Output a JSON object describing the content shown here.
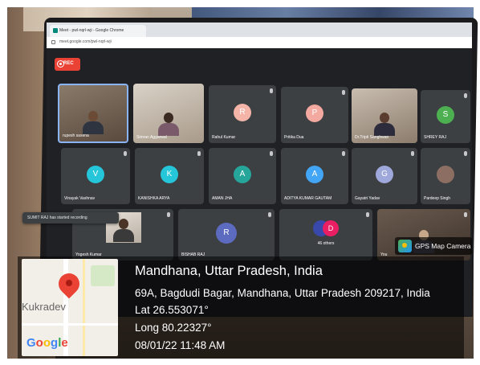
{
  "browser": {
    "tab_title": "Meet - pwl-nqrl-wji - Google Chrome",
    "url": "meet.google.com/pwl-nqrl-wji"
  },
  "meet": {
    "rec_label": "REC",
    "toast": "SUMIT RAJ has started recording",
    "participants": [
      {
        "name": "rupesh saxena",
        "kind": "video"
      },
      {
        "name": "Simran Aggarwal",
        "kind": "video"
      },
      {
        "name": "Rahul Kumar",
        "initial": "R",
        "color": "#f4b5a8"
      },
      {
        "name": "Pritika Dua",
        "initial": "P",
        "color": "#f4a9a0"
      },
      {
        "name": "Dr.Tripti Sanghwan",
        "kind": "video"
      },
      {
        "name": "SHREY RAJ",
        "initial": "S",
        "color": "#4caf50"
      },
      {
        "name": "Vinayak Vashnav",
        "initial": "V",
        "color": "#26c6da"
      },
      {
        "name": "KANISHKA ARYA",
        "initial": "K",
        "color": "#26c6da"
      },
      {
        "name": "AMAN JHA",
        "initial": "A",
        "color": "#26a69a"
      },
      {
        "name": "ADITYA KUMAR GAUTAM",
        "initial": "A",
        "color": "#42a5f5"
      },
      {
        "name": "Gayatri Yadav",
        "initial": "G",
        "color": "#9fa8da"
      },
      {
        "name": "Pardeep Singh",
        "kind": "photo"
      },
      {
        "name": "Yogesh Kumar",
        "kind": "video"
      },
      {
        "name": "BISHAB RAJ",
        "initial": "R",
        "color": "#5c6bc0"
      },
      {
        "name": "46 others",
        "kind": "others",
        "initial": "D"
      },
      {
        "name": "You",
        "kind": "video"
      }
    ]
  },
  "gps": {
    "badge": "GPS Map Camera",
    "map_place": "Kukradev",
    "map_logo": "Google",
    "title": "Mandhana, Uttar Pradesh, India",
    "address": "69A, Bagdudi Bagar, Mandhana, Uttar Pradesh 209217, India",
    "lat": "Lat 26.553071°",
    "long": "Long 80.22327°",
    "datetime": "08/01/22 11:48 AM"
  }
}
